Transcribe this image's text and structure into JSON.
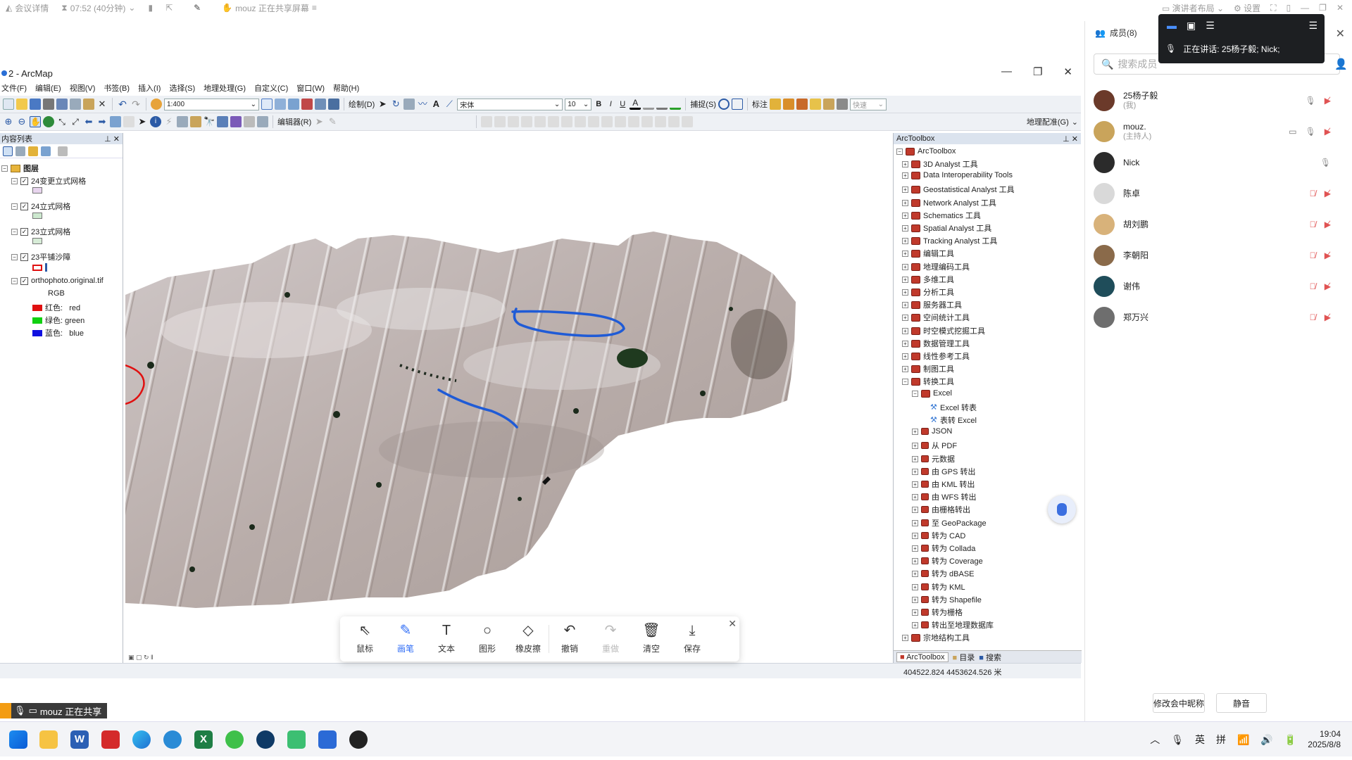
{
  "meeting_bar": {
    "items": [
      "会议详情",
      "07:52 (40分钟)",
      "mouz 正在共享屏幕"
    ],
    "right_items": [
      "演讲者布局",
      "设置"
    ]
  },
  "speaking": {
    "label": "正在讲话: 25杨子毅; Nick;"
  },
  "window": {
    "title": "2 - ArcMap"
  },
  "menu": [
    "文件(F)",
    "编辑(E)",
    "视图(V)",
    "书签(B)",
    "插入(I)",
    "选择(S)",
    "地理处理(G)",
    "自定义(C)",
    "窗口(W)",
    "帮助(H)"
  ],
  "toolbar1": {
    "scale": "1:400",
    "draw_label": "绘制(D)",
    "font": "宋体",
    "font_size": "10",
    "bold": "B",
    "italic": "I",
    "underline": "U",
    "snap_label": "捕捉(S)",
    "annotate_label": "标注",
    "quick_label": "快速"
  },
  "toolbar2": {
    "editor_label": "编辑器(R)",
    "georef_label": "地理配准(G)"
  },
  "toc": {
    "title": "内容列表",
    "root": "图层",
    "layers": [
      {
        "name": "24变更立式网格",
        "swatch": "#e8d5ee"
      },
      {
        "name": "24立式网格",
        "swatch": "#cde9cf"
      },
      {
        "name": "23立式网格",
        "swatch": "#d7ecd7"
      },
      {
        "name": "23平铺沙障"
      }
    ],
    "raster": {
      "name": "orthophoto.original.tif",
      "mode": "RGB",
      "bands": [
        {
          "label": "红色:   red",
          "color": "#e01010"
        },
        {
          "label": "绿色: green",
          "color": "#10d010"
        },
        {
          "label": "蓝色:   blue",
          "color": "#1010e0"
        }
      ]
    }
  },
  "arctoolbox": {
    "title": "ArcToolbox",
    "root": "ArcToolbox",
    "toolsets": [
      "3D Analyst 工具",
      "Data Interoperability Tools",
      "Geostatistical Analyst 工具",
      "Network Analyst 工具",
      "Schematics 工具",
      "Spatial Analyst 工具",
      "Tracking Analyst 工具",
      "编辑工具",
      "地理编码工具",
      "多维工具",
      "分析工具",
      "服务器工具",
      "空间统计工具",
      "时空模式挖掘工具",
      "数据管理工具",
      "线性参考工具",
      "制图工具",
      "转换工具"
    ],
    "conversion_children": [
      "Excel",
      "Excel 转表",
      "表转 Excel",
      "JSON",
      "从 PDF",
      "元数据",
      "由 GPS 转出",
      "由 KML 转出",
      "由 WFS 转出",
      "由栅格转出",
      "至 GeoPackage",
      "转为 CAD",
      "转为 Collada",
      "转为 Coverage",
      "转为 dBASE",
      "转为 KML",
      "转为 Shapefile",
      "转为栅格",
      "转出至地理数据库"
    ],
    "last": "宗地结构工具",
    "tabs": [
      "ArcToolbox",
      "目录",
      "搜索"
    ]
  },
  "status": {
    "coords": "404522.824  4453624.526 米"
  },
  "annot_toolbar": {
    "tools": [
      {
        "label": "鼠标",
        "icon": "cursor-icon"
      },
      {
        "label": "画笔",
        "icon": "pen-icon",
        "active": true
      },
      {
        "label": "文本",
        "icon": "text-icon"
      },
      {
        "label": "图形",
        "icon": "shape-icon"
      },
      {
        "label": "橡皮擦",
        "icon": "eraser-icon"
      },
      {
        "label": "撤销",
        "icon": "undo-icon"
      },
      {
        "label": "重做",
        "icon": "redo-icon",
        "disabled": true
      },
      {
        "label": "清空",
        "icon": "trash-icon"
      },
      {
        "label": "保存",
        "icon": "download-icon"
      }
    ]
  },
  "share_badge": "mouz 正在共享",
  "members": {
    "title": "成员(8)",
    "search_placeholder": "搜索成员",
    "list": [
      {
        "name": "25杨子毅",
        "sub": "(我)",
        "mic": "on",
        "cam": "off",
        "avatar": "#6b3a2a"
      },
      {
        "name": "mouz.",
        "sub": "(主持人)",
        "mic": "on",
        "cam": "off",
        "share": true,
        "avatar": "#c9a45b"
      },
      {
        "name": "Nick",
        "sub": "",
        "mic": "on",
        "avatar": "#2b2b2b"
      },
      {
        "name": "陈卓",
        "sub": "",
        "mic": "off",
        "cam": "off",
        "avatar": "#d9d9d9"
      },
      {
        "name": "胡刘鹏",
        "sub": "",
        "mic": "off",
        "cam": "off",
        "avatar": "#d8b27a"
      },
      {
        "name": "李朝阳",
        "sub": "",
        "mic": "off",
        "cam": "off",
        "avatar": "#8a6a4a"
      },
      {
        "name": "谢伟",
        "sub": "",
        "mic": "off",
        "cam": "off",
        "avatar": "#1f4d5a"
      },
      {
        "name": "郑万兴",
        "sub": "",
        "mic": "off",
        "cam": "off",
        "avatar": "#6e6e6e"
      }
    ],
    "buttons": [
      "修改会中昵称",
      "静音"
    ]
  },
  "taskbar": {
    "tray": [
      "英",
      "拼"
    ],
    "time": "19:04",
    "date": "2025/8/8"
  }
}
